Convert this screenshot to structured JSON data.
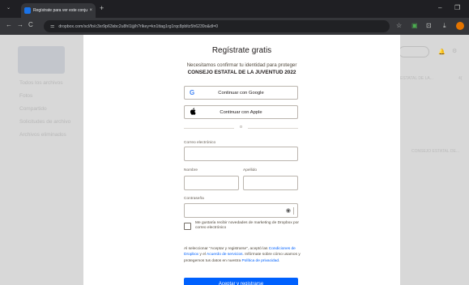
{
  "browser": {
    "tab_title": "Regístrate para ver este conjunt",
    "tab_close": "×",
    "new_tab": "+",
    "tab_menu": "⌄",
    "minimize": "–",
    "restore": "❐",
    "url": "dropbox.com/scl/fo/c3xr9p63sbc2u8hl1ijj/h?rlkey=kn1ttag1rg1rqc8pbltz5h6239o&dl=0",
    "back": "←",
    "forward": "→",
    "reload": "C",
    "site_info": "⚌",
    "bookmark": "☆",
    "ext1": "▣",
    "ext2": "⊡",
    "download": "⤓"
  },
  "background": {
    "sidebar": [
      "Todos los archivos",
      "Fotos",
      "Compartido",
      "Solicitudes de archivo",
      "Archivos eliminados"
    ],
    "col_header": "ESTATAL DE LA...",
    "col_right": "4(",
    "row_text": "CONSEJO ESTATAL DE...",
    "bell": "🔔",
    "gear": "⚙"
  },
  "modal": {
    "title": "Regístrate gratis",
    "subtitle": "Necesitamos confirmar tu identidad para proteger",
    "org": "CONSEJO ESTATAL DE LA JUVENTUD 2022",
    "google_label": "Continuar con Google",
    "google_icon": "G",
    "apple_label": "Continuar con Apple",
    "apple_icon": "",
    "divider": "o",
    "email_label": "Correo electrónico",
    "first_name_label": "Nombre",
    "last_name_label": "Apellido",
    "password_label": "Contraseña",
    "eye_icon": "◉",
    "marketing_label": "Me gustaría recibir novedades de marketing de Dropbox por correo electrónico",
    "legal_pre": "Al seleccionar \"Aceptar y registrarse\", aceptó las ",
    "legal_link1": "Condiciones de Dropbox",
    "legal_mid1": " y el ",
    "legal_link2": "Acuerdo de servicios",
    "legal_mid2": ". Infórmate sobre cómo usamos y protegemos tus datos en nuestra ",
    "legal_link3": "Política de privacidad",
    "legal_end": ".",
    "submit_label": "Aceptar y registrarse"
  },
  "colors": {
    "accent": "#0061fe",
    "google_blue": "#4285f4"
  }
}
